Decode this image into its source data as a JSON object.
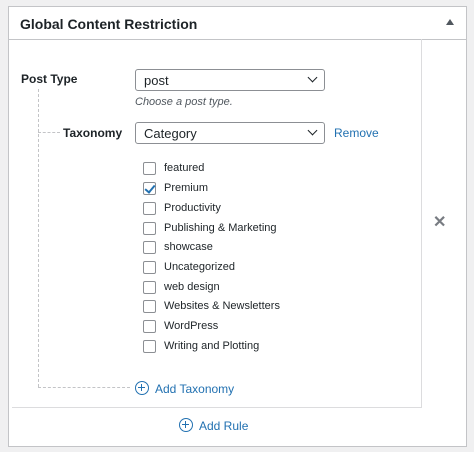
{
  "panel": {
    "title": "Global Content Restriction",
    "collapse_icon": "triangle-up-icon"
  },
  "rule": {
    "post_type_label": "Post Type",
    "post_type_value": "post",
    "post_type_hint": "Choose a post type.",
    "taxonomy_label": "Taxonomy",
    "taxonomy_value": "Category",
    "remove_label": "Remove",
    "terms": [
      {
        "label": "featured",
        "checked": false
      },
      {
        "label": "Premium",
        "checked": true
      },
      {
        "label": "Productivity",
        "checked": false
      },
      {
        "label": "Publishing & Marketing",
        "checked": false
      },
      {
        "label": "showcase",
        "checked": false
      },
      {
        "label": "Uncategorized",
        "checked": false
      },
      {
        "label": "web design",
        "checked": false
      },
      {
        "label": "Websites & Newsletters",
        "checked": false
      },
      {
        "label": "WordPress",
        "checked": false
      },
      {
        "label": "Writing and Plotting",
        "checked": false
      }
    ],
    "add_taxonomy_label": "Add Taxonomy",
    "delete_icon": "x-icon"
  },
  "footer": {
    "add_rule_label": "Add Rule"
  },
  "colors": {
    "accent": "#2271b1",
    "border": "#c3c4c7",
    "text": "#1d2327"
  }
}
